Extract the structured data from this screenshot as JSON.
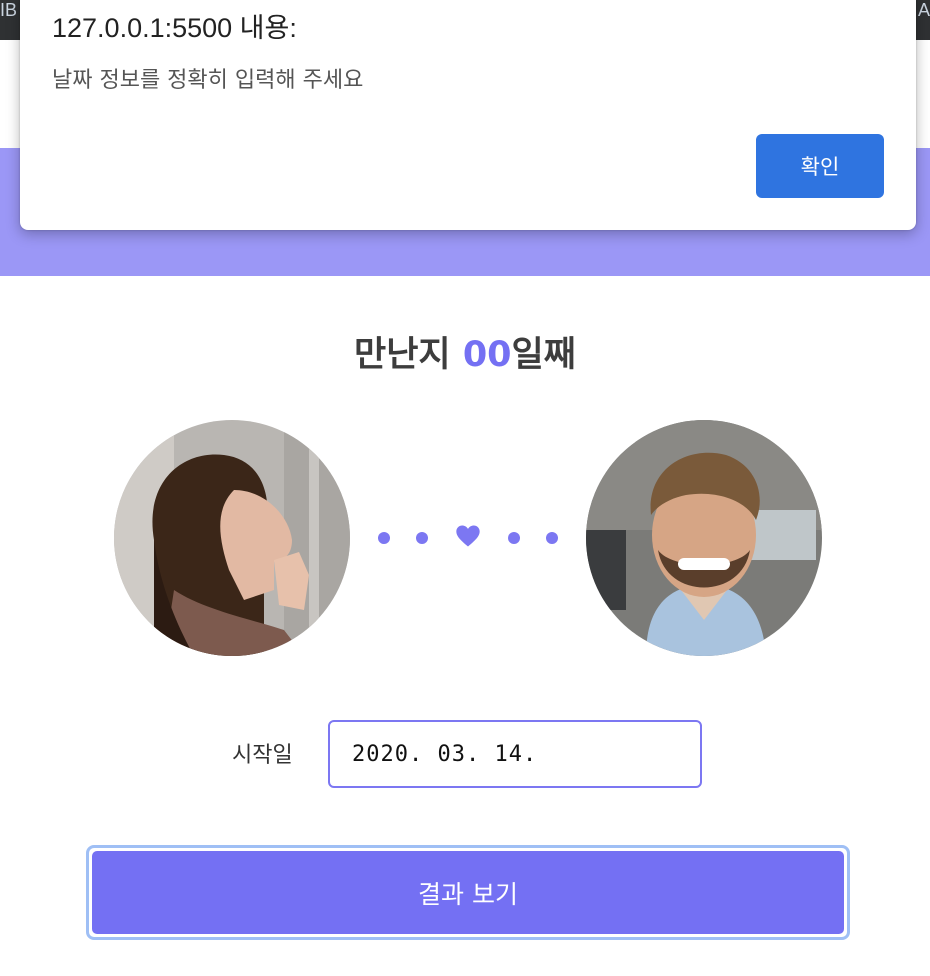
{
  "browser": {
    "edge_left_text": "IB",
    "edge_right_text": "A"
  },
  "dialog": {
    "title": "127.0.0.1:5500 내용:",
    "message": "날짜 정보를 정확히 입력해 주세요",
    "ok_label": "확인"
  },
  "headline": {
    "prefix": "만난지 ",
    "number": "00",
    "suffix": "일째"
  },
  "avatars": {
    "left_icon": "woman-photo",
    "right_icon": "man-photo"
  },
  "connector": {
    "icon": "heart-icon",
    "color": "#7c77f2"
  },
  "form": {
    "start_label": "시작일",
    "start_value": "2020. 03. 14."
  },
  "result_button": {
    "label": "결과 보기",
    "color": "#7470f3"
  },
  "colors": {
    "accent": "#7470f3",
    "band": "#9b97f6",
    "dialog_button": "#2f74e0"
  }
}
